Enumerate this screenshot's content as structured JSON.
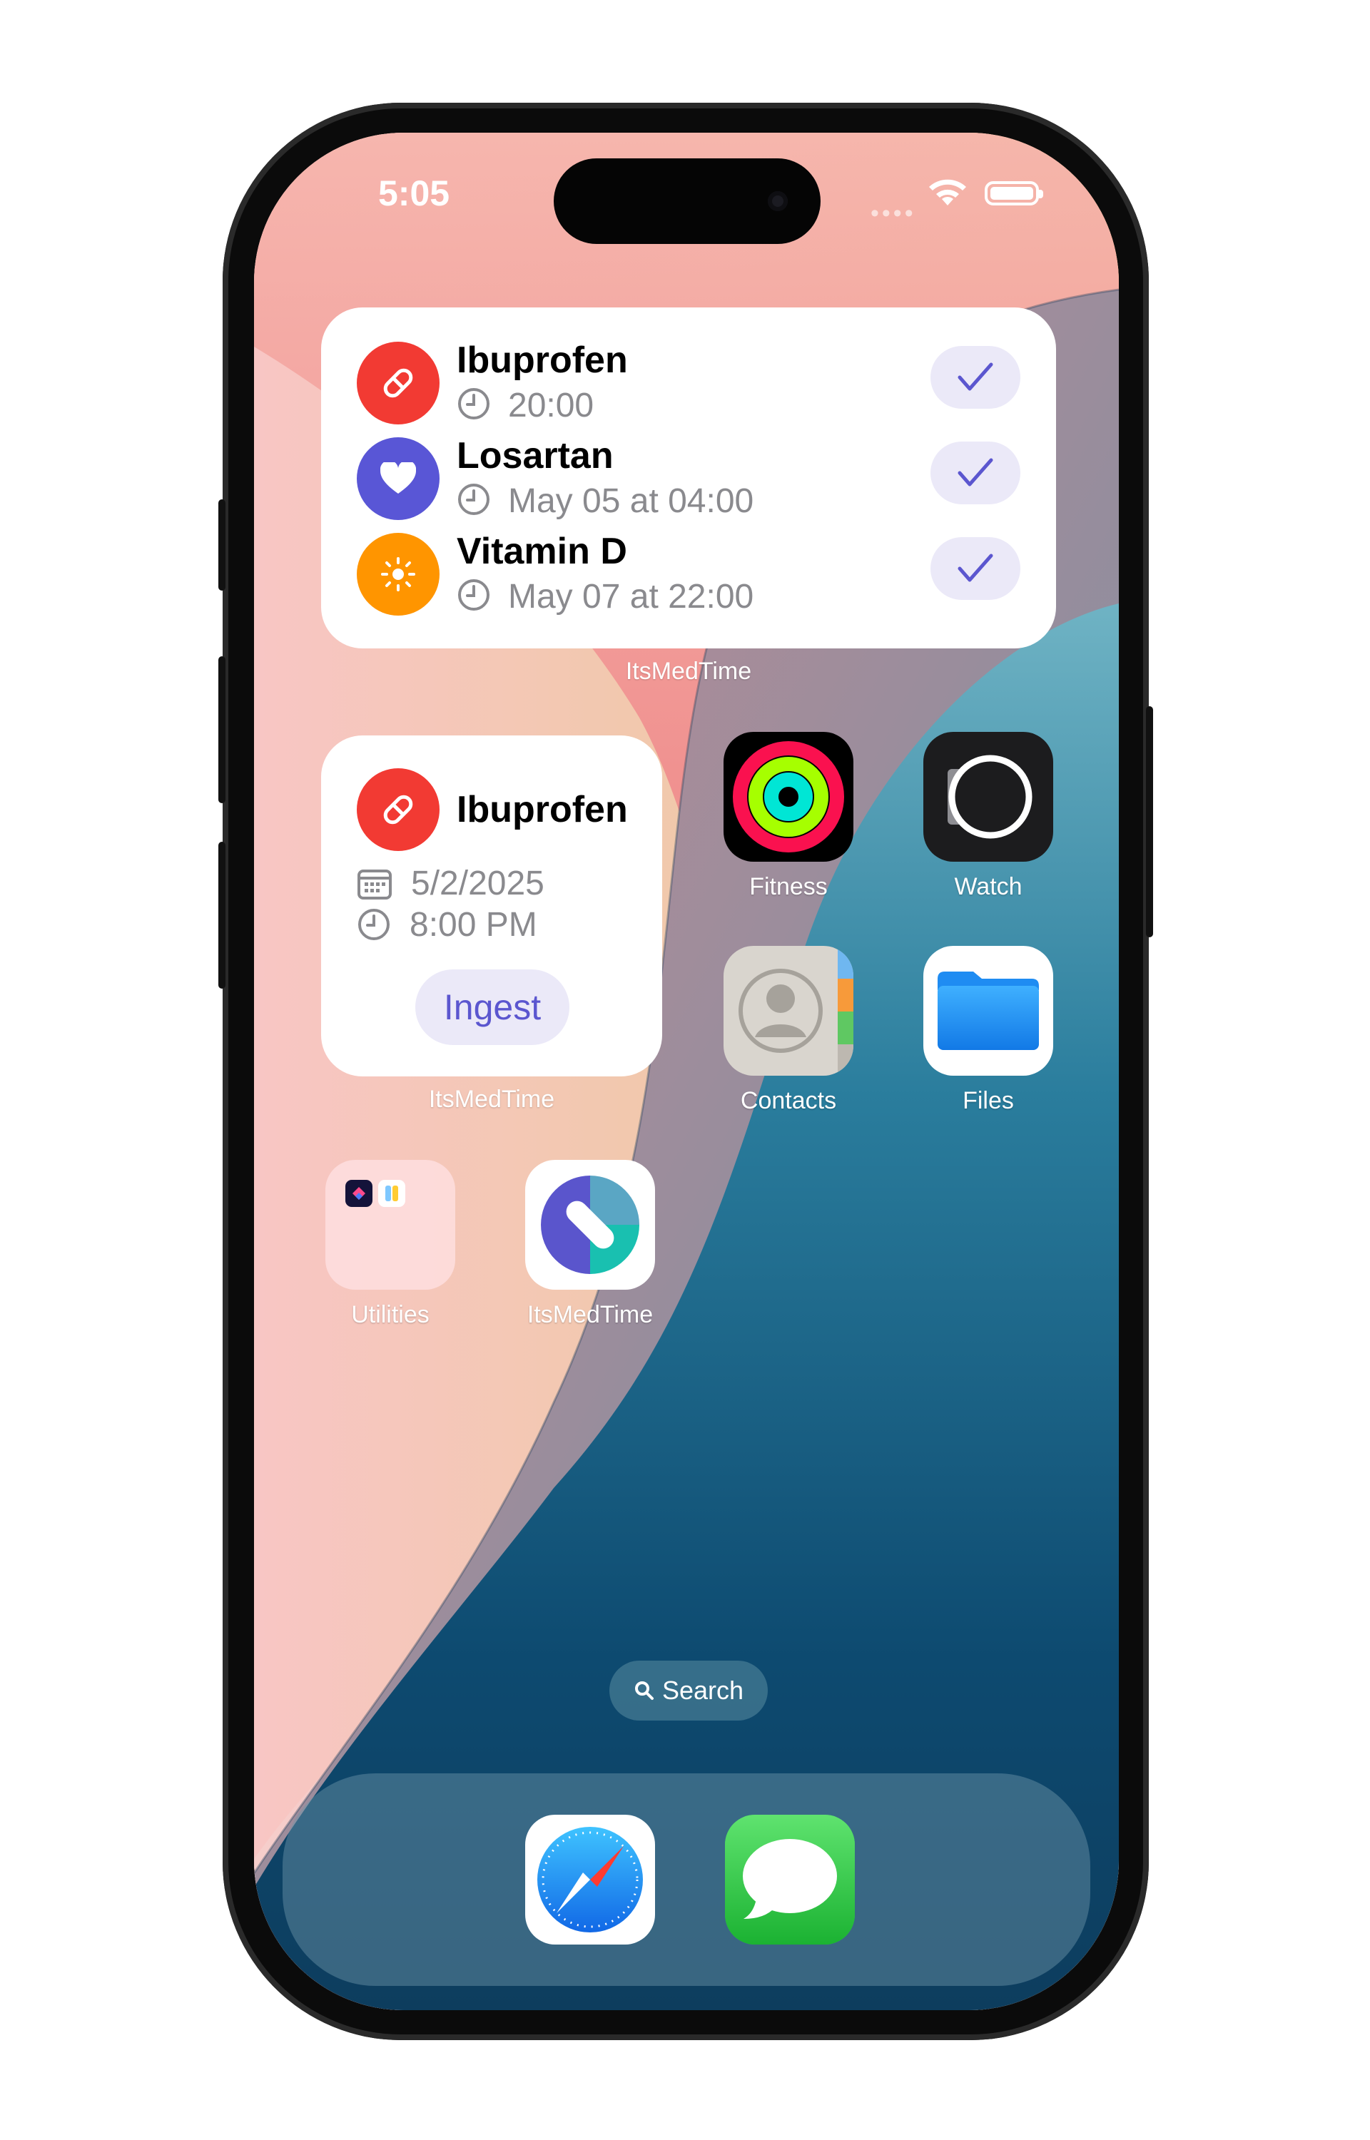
{
  "status_bar": {
    "time": "5:05",
    "signal_icon": "signal-dots-icon",
    "wifi_icon": "wifi-icon",
    "battery_icon": "battery-icon"
  },
  "colors": {
    "accent_purple": "#5b56cf",
    "red": "#f23a33",
    "indigo": "#5956d6",
    "orange": "#ff9500",
    "button_bg": "#ebe9f8",
    "secondary_text": "#8a8a8e"
  },
  "large_widget": {
    "caption": "ItsMedTime",
    "items": [
      {
        "name": "Ibuprofen",
        "time": "20:00",
        "icon": "pill-icon",
        "color": "#f23a33"
      },
      {
        "name": "Losartan",
        "time": "May 05 at 04:00",
        "icon": "heart-icon",
        "color": "#5956d6"
      },
      {
        "name": "Vitamin D",
        "time": "May 07 at 22:00",
        "icon": "sun-icon",
        "color": "#ff9500"
      }
    ]
  },
  "small_widget": {
    "caption": "ItsMedTime",
    "name": "Ibuprofen",
    "date": "5/2/2025",
    "time": "8:00 PM",
    "button": "Ingest"
  },
  "apps": [
    {
      "label": "Fitness",
      "icon": "fitness-rings-icon"
    },
    {
      "label": "Watch",
      "icon": "watch-icon"
    },
    {
      "label": "Contacts",
      "icon": "contacts-icon"
    },
    {
      "label": "Files",
      "icon": "folder-icon"
    },
    {
      "label": "Utilities",
      "icon": "folder-utilities-icon"
    },
    {
      "label": "ItsMedTime",
      "icon": "itsmedtime-app-icon"
    }
  ],
  "search": {
    "label": "Search"
  },
  "dock": [
    {
      "icon": "safari-compass-icon"
    },
    {
      "icon": "messages-bubble-icon"
    }
  ]
}
